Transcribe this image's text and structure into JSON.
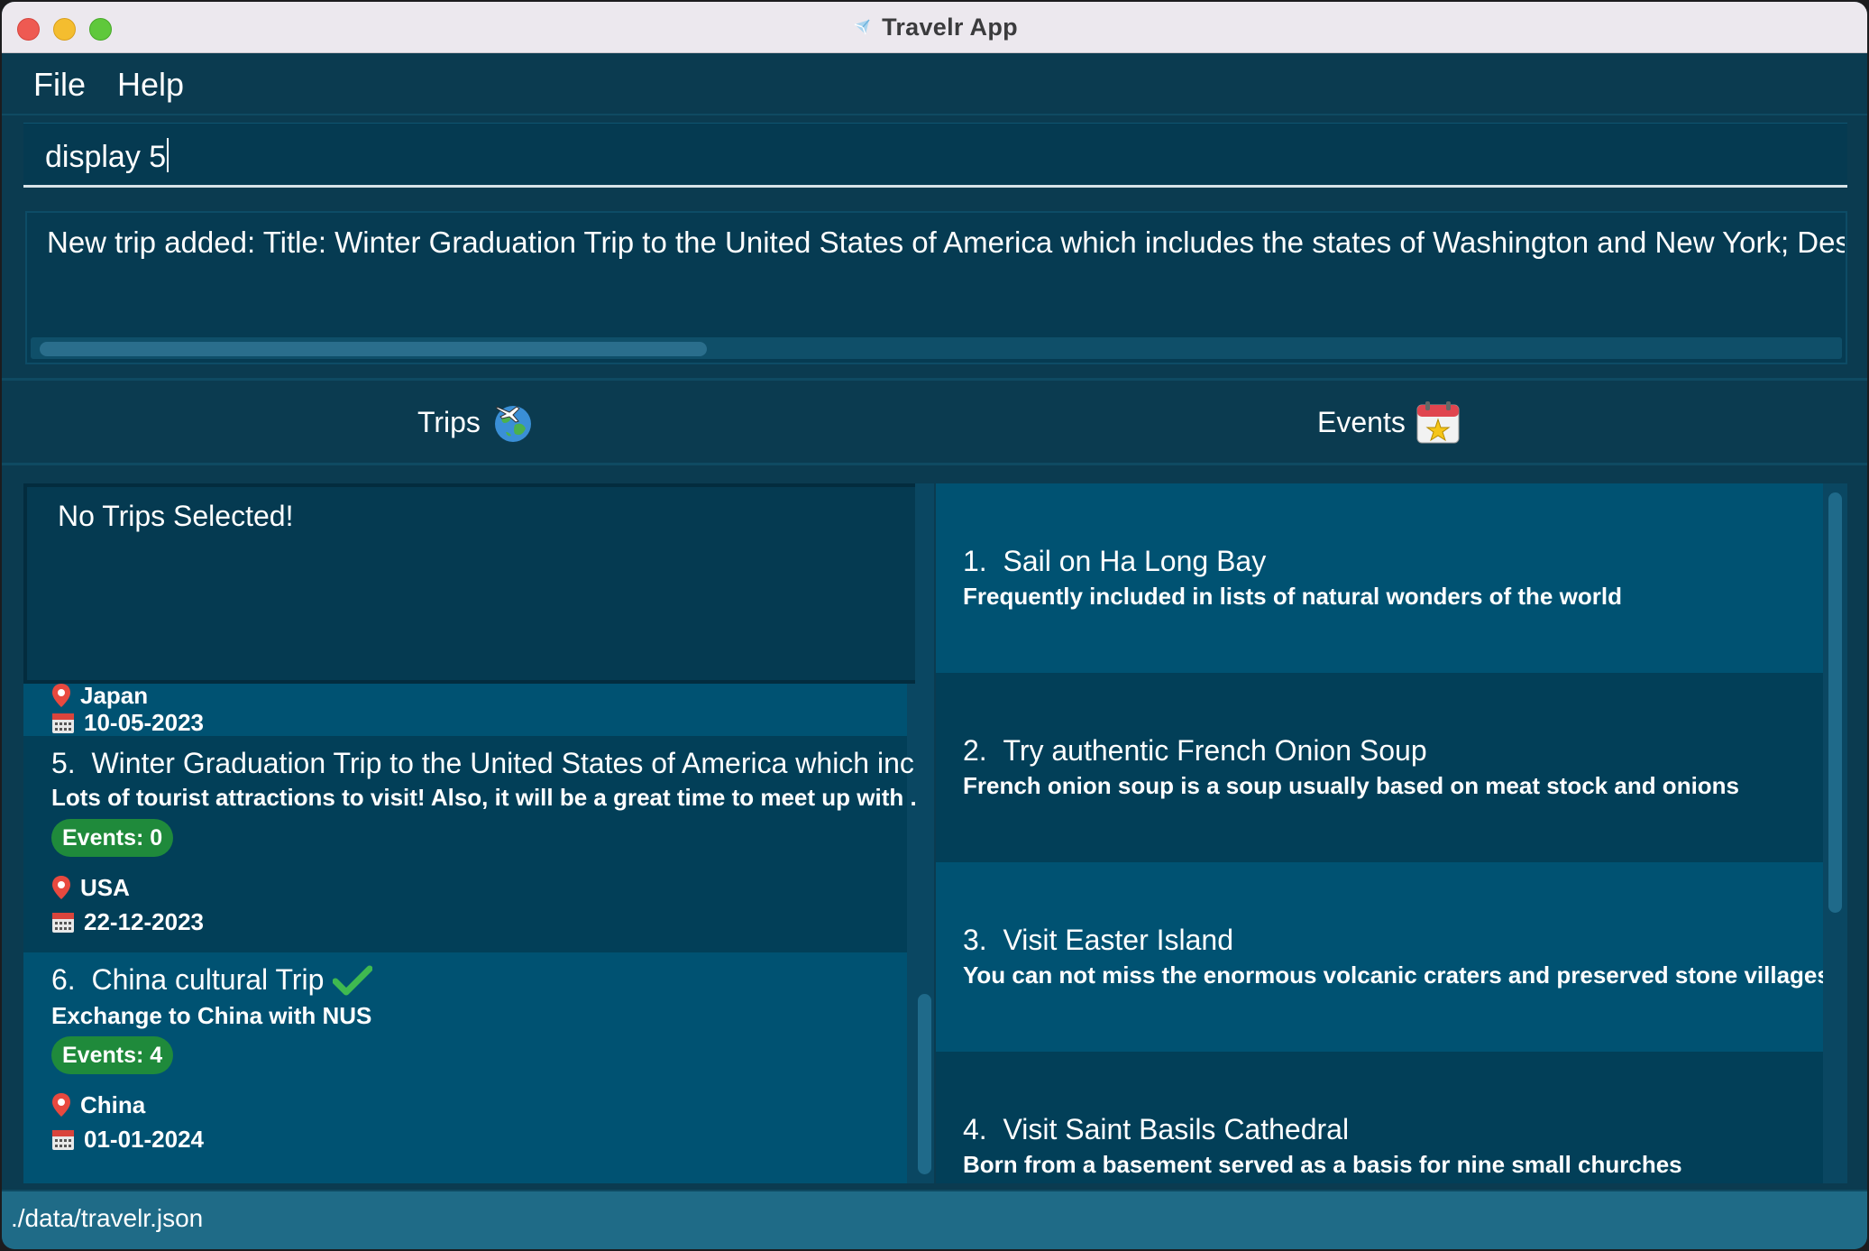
{
  "window": {
    "title": "Travelr App"
  },
  "menu": {
    "file": "File",
    "help": "Help"
  },
  "command": {
    "value": "display 5"
  },
  "result": {
    "text": "New trip added: Title: Winter Graduation Trip to the United States of America which includes the states of Washington and New York; Description"
  },
  "headers": {
    "trips": "Trips",
    "events": "Events"
  },
  "selected_trip": {
    "text": "No Trips Selected!"
  },
  "trips": [
    {
      "location": "Japan",
      "date": "10-05-2023"
    },
    {
      "index": "5.",
      "title": "Winter Graduation Trip to the United States of America which incl...",
      "description": "Lots of tourist attractions to visit! Also, it will be a great time to meet up with ...",
      "events": "Events: 0",
      "location": "USA",
      "date": "22-12-2023"
    },
    {
      "index": "6.",
      "title": "China cultural Trip",
      "completed": true,
      "description": "Exchange to China with NUS",
      "events": "Events: 4",
      "location": "China",
      "date": "01-01-2024"
    }
  ],
  "events": [
    {
      "index": "1.",
      "title": "Sail on Ha Long Bay",
      "description": "Frequently included in lists of natural wonders of the world"
    },
    {
      "index": "2.",
      "title": "Try authentic French Onion Soup",
      "description": "French onion soup is a soup usually based on meat stock and onions"
    },
    {
      "index": "3.",
      "title": "Visit Easter Island",
      "description": "You can not miss the enormous volcanic craters and preserved stone villages"
    },
    {
      "index": "4.",
      "title": "Visit Saint Basils Cathedral",
      "description": "Born from a basement served as a basis for nine small churches"
    }
  ],
  "status": {
    "path": "./data/travelr.json"
  },
  "colors": {
    "background": "#0b3b50",
    "card_light": "#005272",
    "card_dark": "#023f58",
    "badge_green": "#1f8a3b",
    "check_green": "#3fb950",
    "status_bar": "#1f6b87"
  }
}
